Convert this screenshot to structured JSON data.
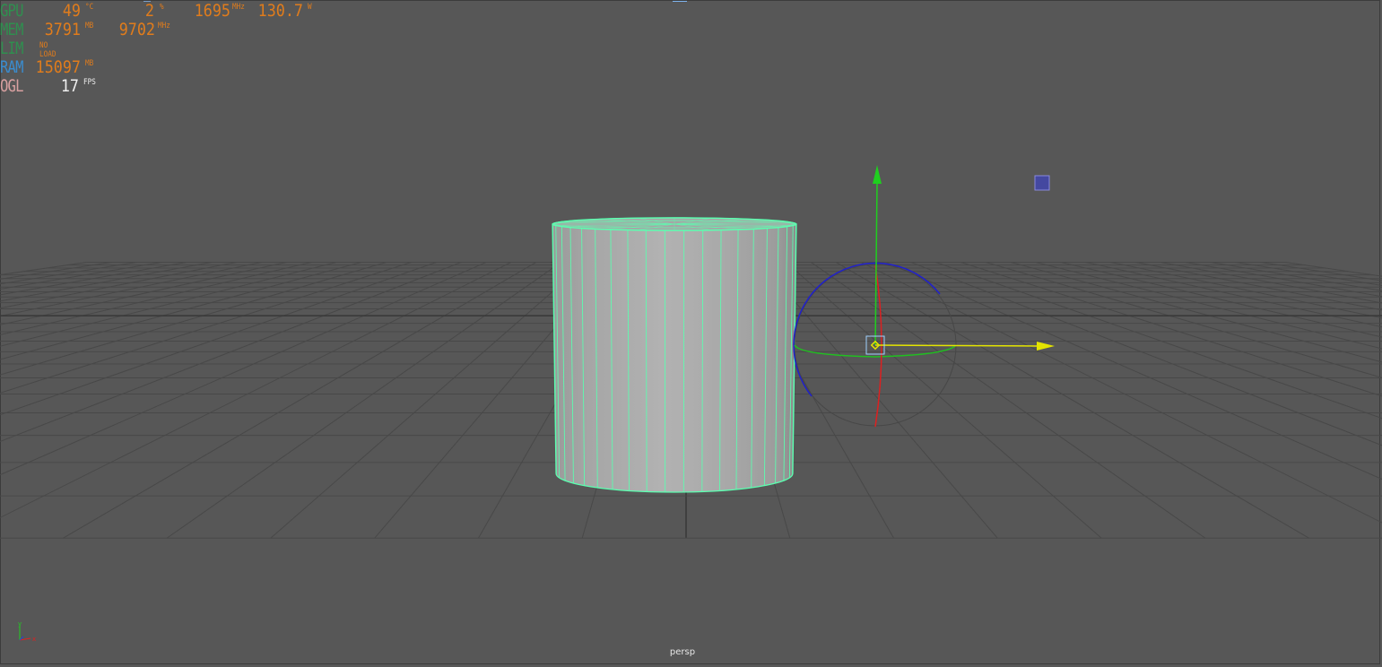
{
  "hud": {
    "gpu": {
      "label": "GPU",
      "temp": "49",
      "temp_unit": "°C",
      "load": "2",
      "load_unit": "%",
      "clock": "1695",
      "clock_unit": "MHz",
      "power": "130.7",
      "power_unit": "W"
    },
    "mem": {
      "label": "MEM",
      "used": "3791",
      "used_unit": "MB",
      "clock": "9702",
      "clock_unit": "MHz"
    },
    "lim": {
      "label": "LIM",
      "status": "NO LOAD"
    },
    "ram": {
      "label": "RAM",
      "used": "15097",
      "used_unit": "MB"
    },
    "ogl": {
      "label": "OGL",
      "fps": "17",
      "fps_unit": "FPS"
    }
  },
  "viewport": {
    "camera_name": "persp",
    "background": "#575757",
    "grid_color": "#484848",
    "wireframe_color": "#5bffb0"
  },
  "axis_indicator": {
    "x_label": "x",
    "y_label": "y"
  },
  "colors": {
    "gpu_label": "#2f8f4f",
    "mem_label": "#2f8f4f",
    "lim_label": "#2f8f4f",
    "ram_label": "#3a8ccf",
    "ogl_label": "#d8a0a0",
    "value": "#e07c1c",
    "manip_x": "#e4e400",
    "manip_y": "#1fcf1f",
    "manip_rot_x": "#dd2020",
    "manip_rot_y": "#20c020",
    "manip_rot_z": "#2020cc"
  }
}
